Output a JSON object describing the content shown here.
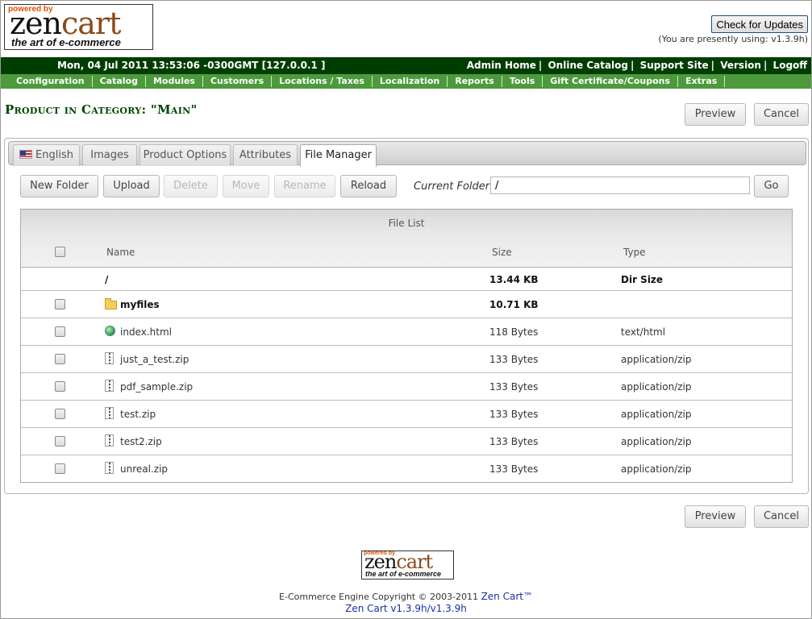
{
  "logo": {
    "powered_by": "powered by",
    "zen": "zen",
    "cart": "cart",
    "tagline": "the art of e-commerce"
  },
  "header": {
    "check_updates": "Check for Updates",
    "using": "(You are presently using: v1.3.9h)"
  },
  "topbar": {
    "datetime": "Mon, 04 Jul 2011 13:53:06 -0300GMT [127.0.0.1 ]",
    "links": [
      "Admin Home",
      "Online Catalog",
      "Support Site",
      "Version",
      "Logoff"
    ]
  },
  "menu": [
    "Configuration",
    "Catalog",
    "Modules",
    "Customers",
    "Locations / Taxes",
    "Localization",
    "Reports",
    "Tools",
    "Gift Certificate/Coupons",
    "Extras"
  ],
  "page": {
    "title": "Product in Category: \"Main\"",
    "preview": "Preview",
    "cancel": "Cancel"
  },
  "tabs": [
    "English",
    "Images",
    "Product Options",
    "Attributes",
    "File Manager"
  ],
  "toolbar": {
    "new_folder": "New Folder",
    "upload": "Upload",
    "delete": "Delete",
    "move": "Move",
    "rename": "Rename",
    "reload": "Reload",
    "current_folder_label": "Current Folder:",
    "current_folder_value": "/",
    "go": "Go"
  },
  "file_list": {
    "title": "File List",
    "columns": {
      "name": "Name",
      "size": "Size",
      "type": "Type"
    },
    "rows": [
      {
        "name": "/",
        "size": "13.44 KB",
        "type": "Dir Size",
        "icon": "none"
      },
      {
        "name": "myfiles",
        "size": "10.71 KB",
        "type": "",
        "icon": "folder-icon"
      },
      {
        "name": "index.html",
        "size": "118 Bytes",
        "type": "text/html",
        "icon": "globe-icon"
      },
      {
        "name": "just_a_test.zip",
        "size": "133 Bytes",
        "type": "application/zip",
        "icon": "zip-icon"
      },
      {
        "name": "pdf_sample.zip",
        "size": "133 Bytes",
        "type": "application/zip",
        "icon": "zip-icon"
      },
      {
        "name": "test.zip",
        "size": "133 Bytes",
        "type": "application/zip",
        "icon": "zip-icon"
      },
      {
        "name": "test2.zip",
        "size": "133 Bytes",
        "type": "application/zip",
        "icon": "zip-icon"
      },
      {
        "name": "unreal.zip",
        "size": "133 Bytes",
        "type": "application/zip",
        "icon": "zip-icon"
      }
    ]
  },
  "footer": {
    "copyright_text": "E-Commerce Engine Copyright © 2003-2011",
    "copyright_link": "Zen Cart™",
    "version_link": "Zen Cart v1.3.9h/v1.3.9h"
  },
  "colors": {
    "topbar": "#003d00",
    "menubar": "#4c9a3c",
    "title": "#004400",
    "link": "#1a2fa8"
  }
}
